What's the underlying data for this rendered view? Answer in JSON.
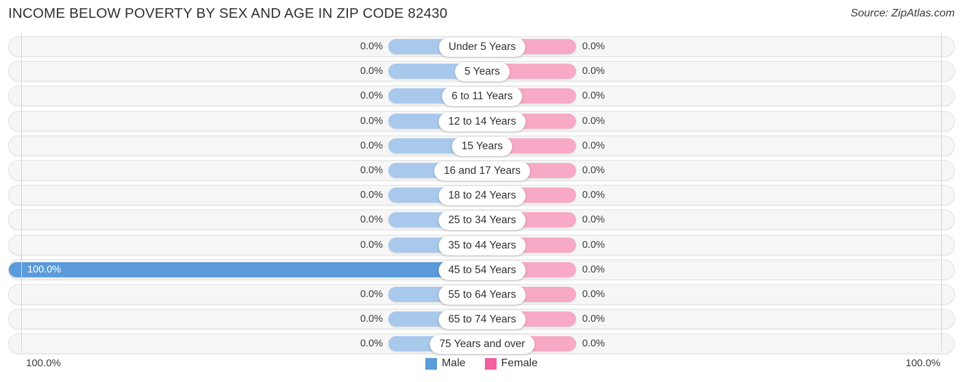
{
  "header": {
    "title": "INCOME BELOW POVERTY BY SEX AND AGE IN ZIP CODE 82430",
    "source": "Source: ZipAtlas.com"
  },
  "axis": {
    "left_label": "100.0%",
    "right_label": "100.0%"
  },
  "legend": {
    "items": [
      {
        "label": "Male",
        "color": "#5b9bd9"
      },
      {
        "label": "Female",
        "color": "#f2609e"
      }
    ]
  },
  "colors": {
    "male_light": "#a9c9ec",
    "male_full": "#5b9bd9",
    "female_light": "#f7a9c5",
    "row_background": "#f6f6f6",
    "row_border": "#e2e2e2",
    "axis_line": "#d4d4d4"
  },
  "chart_data": {
    "type": "bar",
    "title": "INCOME BELOW POVERTY BY SEX AND AGE IN ZIP CODE 82430",
    "subtitle": "Source: ZipAtlas.com",
    "orientation": "horizontal-diverging",
    "xlabel": "",
    "ylabel": "",
    "xlim": [
      -100.0,
      100.0
    ],
    "axis_tick_labels": [
      "100.0%",
      "100.0%"
    ],
    "grid": false,
    "legend_position": "bottom-center",
    "categories": [
      "Under 5 Years",
      "5 Years",
      "6 to 11 Years",
      "12 to 14 Years",
      "15 Years",
      "16 and 17 Years",
      "18 to 24 Years",
      "25 to 34 Years",
      "35 to 44 Years",
      "45 to 54 Years",
      "55 to 64 Years",
      "65 to 74 Years",
      "75 Years and over"
    ],
    "series": [
      {
        "name": "Male",
        "values": [
          0.0,
          0.0,
          0.0,
          0.0,
          0.0,
          0.0,
          0.0,
          0.0,
          0.0,
          100.0,
          0.0,
          0.0,
          0.0
        ],
        "labels": [
          "0.0%",
          "0.0%",
          "0.0%",
          "0.0%",
          "0.0%",
          "0.0%",
          "0.0%",
          "0.0%",
          "0.0%",
          "100.0%",
          "0.0%",
          "0.0%",
          "0.0%"
        ]
      },
      {
        "name": "Female",
        "values": [
          0.0,
          0.0,
          0.0,
          0.0,
          0.0,
          0.0,
          0.0,
          0.0,
          0.0,
          0.0,
          0.0,
          0.0,
          0.0
        ],
        "labels": [
          "0.0%",
          "0.0%",
          "0.0%",
          "0.0%",
          "0.0%",
          "0.0%",
          "0.0%",
          "0.0%",
          "0.0%",
          "0.0%",
          "0.0%",
          "0.0%",
          "0.0%"
        ]
      }
    ]
  },
  "rows": [
    {
      "label": "Under 5 Years",
      "male": "0.0%",
      "female": "0.0%",
      "male_value": 0.0,
      "female_value": 0.0
    },
    {
      "label": "5 Years",
      "male": "0.0%",
      "female": "0.0%",
      "male_value": 0.0,
      "female_value": 0.0
    },
    {
      "label": "6 to 11 Years",
      "male": "0.0%",
      "female": "0.0%",
      "male_value": 0.0,
      "female_value": 0.0
    },
    {
      "label": "12 to 14 Years",
      "male": "0.0%",
      "female": "0.0%",
      "male_value": 0.0,
      "female_value": 0.0
    },
    {
      "label": "15 Years",
      "male": "0.0%",
      "female": "0.0%",
      "male_value": 0.0,
      "female_value": 0.0
    },
    {
      "label": "16 and 17 Years",
      "male": "0.0%",
      "female": "0.0%",
      "male_value": 0.0,
      "female_value": 0.0
    },
    {
      "label": "18 to 24 Years",
      "male": "0.0%",
      "female": "0.0%",
      "male_value": 0.0,
      "female_value": 0.0
    },
    {
      "label": "25 to 34 Years",
      "male": "0.0%",
      "female": "0.0%",
      "male_value": 0.0,
      "female_value": 0.0
    },
    {
      "label": "35 to 44 Years",
      "male": "0.0%",
      "female": "0.0%",
      "male_value": 0.0,
      "female_value": 0.0
    },
    {
      "label": "45 to 54 Years",
      "male": "100.0%",
      "female": "0.0%",
      "male_value": 100.0,
      "female_value": 0.0
    },
    {
      "label": "55 to 64 Years",
      "male": "0.0%",
      "female": "0.0%",
      "male_value": 0.0,
      "female_value": 0.0
    },
    {
      "label": "65 to 74 Years",
      "male": "0.0%",
      "female": "0.0%",
      "male_value": 0.0,
      "female_value": 0.0
    },
    {
      "label": "75 Years and over",
      "male": "0.0%",
      "female": "0.0%",
      "male_value": 0.0,
      "female_value": 0.0
    }
  ]
}
